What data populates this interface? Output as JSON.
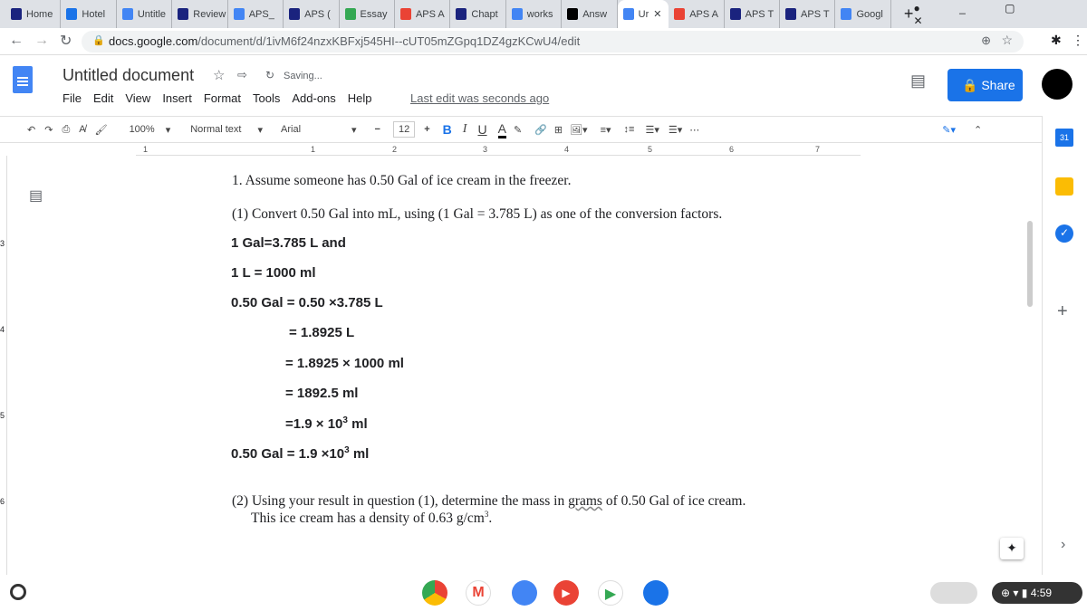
{
  "browser": {
    "tabs": [
      {
        "label": "Home",
        "icon": "bookmark-icon"
      },
      {
        "label": "Hotel",
        "icon": "r-icon"
      },
      {
        "label": "Untitle",
        "icon": "docs-icon"
      },
      {
        "label": "Review",
        "icon": "bookmark-icon"
      },
      {
        "label": "APS_",
        "icon": "docs-icon"
      },
      {
        "label": "APS (",
        "icon": "bookmark-icon"
      },
      {
        "label": "Essay",
        "icon": "check-icon"
      },
      {
        "label": "APS A",
        "icon": "gmail-icon"
      },
      {
        "label": "Chapt",
        "icon": "bookmark-icon"
      },
      {
        "label": "works",
        "icon": "docs-icon"
      },
      {
        "label": "Answ",
        "icon": "b-icon"
      },
      {
        "label": "Ur",
        "icon": "docs-icon",
        "active": true
      },
      {
        "label": "APS A",
        "icon": "gmail-icon"
      },
      {
        "label": "APS T",
        "icon": "bookmark-icon"
      },
      {
        "label": "APS T",
        "icon": "bookmark-icon"
      },
      {
        "label": "Googl",
        "icon": "translate-icon"
      }
    ],
    "url_domain": "docs.google.com",
    "url_path": "/document/d/1ivM6f24nzxKBFxj545HI--cUT05mZGpq1DZ4gzKCwU4/edit"
  },
  "docs": {
    "title": "Untitled document",
    "saving": "Saving...",
    "menu": [
      "File",
      "Edit",
      "View",
      "Insert",
      "Format",
      "Tools",
      "Add-ons",
      "Help"
    ],
    "last_edit": "Last edit was seconds ago",
    "share": "Share",
    "toolbar": {
      "zoom": "100%",
      "style": "Normal text",
      "font": "Arial",
      "size": "12",
      "bold": "B",
      "italic": "I",
      "underline": "U",
      "color": "A",
      "more": "⋯"
    },
    "ruler": [
      "1",
      "1",
      "2",
      "3",
      "4",
      "5",
      "6",
      "7"
    ]
  },
  "content": {
    "q1": "1.  Assume someone has 0.50 Gal of ice cream in the freezer.",
    "p1": "(1) Convert 0.50 Gal into mL, using (1 Gal = 3.785 L) as one of the conversion factors.",
    "lines": [
      "1 Gal=3.785 L and",
      "1 L = 1000 ml",
      "0.50 Gal = 0.50 ×3.785 L",
      "= 1.8925 L",
      "= 1.8925 × 1000 ml",
      "= 1892.5 ml"
    ],
    "sci1_base": "=1.9 × 10",
    "sci1_exp": "3",
    "sci1_unit": " ml",
    "sci2_base": "0.50 Gal = 1.9 ×10",
    "sci2_exp": "3",
    "sci2_unit": " ml",
    "p2_a": "(2) Using your result in question (1), determine the mass in ",
    "p2_grams": "grams",
    "p2_b": " of 0.50 Gal of ice cream.",
    "p2_line2": "This ice cream has a density of 0.63 g/cm",
    "p2_exp": "3",
    "p2_end": "."
  },
  "vruler": [
    "3",
    "4",
    "5",
    "6"
  ],
  "shelf": {
    "time": "4:59"
  }
}
